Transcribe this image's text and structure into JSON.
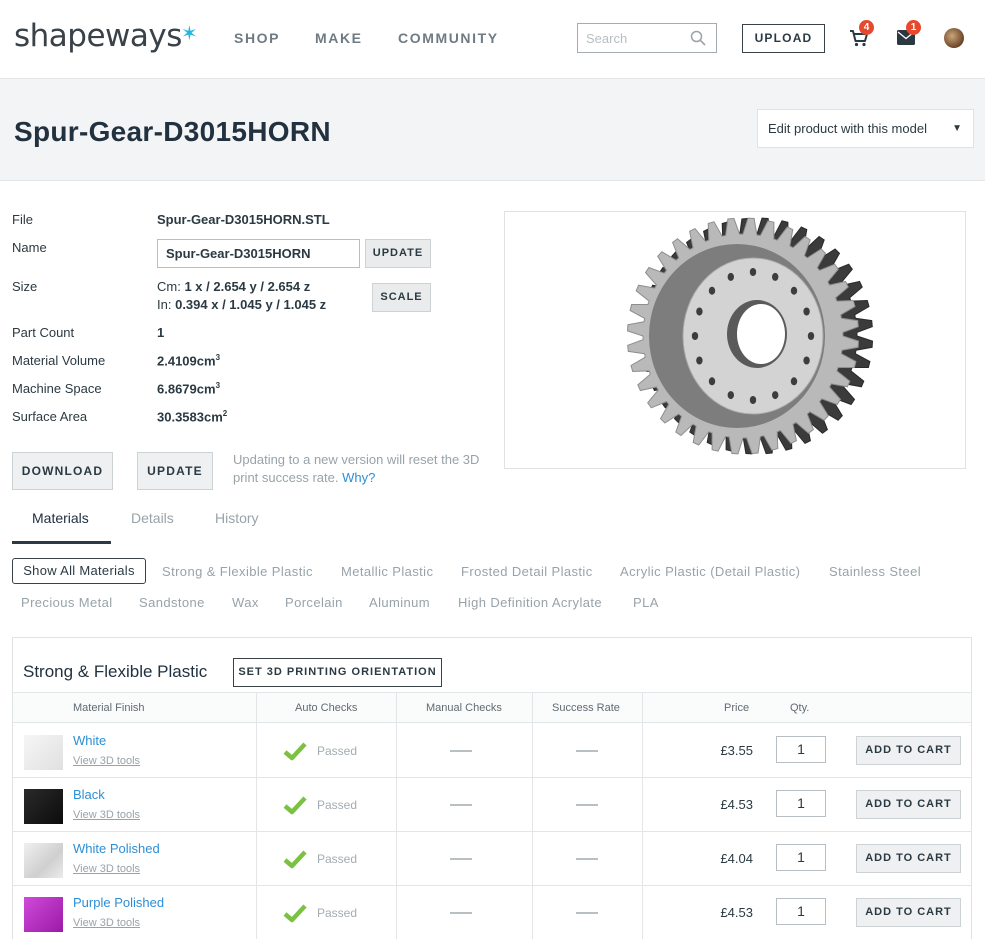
{
  "header": {
    "logo": "shapeways",
    "nav": [
      "SHOP",
      "MAKE",
      "COMMUNITY"
    ],
    "search_placeholder": "Search",
    "upload_label": "UPLOAD",
    "cart_count": "4",
    "mail_count": "1"
  },
  "page": {
    "title": "Spur-Gear-D3015HORN",
    "edit_select": "Edit product with this model"
  },
  "file_info": {
    "file_label": "File",
    "file_value": "Spur-Gear-D3015HORN.STL",
    "name_label": "Name",
    "name_value": "Spur-Gear-D3015HORN",
    "update_small": "UPDATE",
    "size_label": "Size",
    "size_cm_prefix": "Cm:",
    "size_cm": "1 x / 2.654 y / 2.654 z",
    "size_in_prefix": "In:",
    "size_in": "0.394 x / 1.045 y / 1.045 z",
    "scale_label": "SCALE",
    "part_count_label": "Part Count",
    "part_count": "1",
    "material_volume_label": "Material Volume",
    "material_volume": "2.4109cm",
    "machine_space_label": "Machine Space",
    "machine_space": "6.8679cm",
    "surface_area_label": "Surface Area",
    "surface_area": "30.3583cm",
    "unit_sup_3": "3",
    "unit_sup_2": "2",
    "download_label": "DOWNLOAD",
    "update_label": "UPDATE",
    "note": "Updating to a new version will reset the 3D print success rate.",
    "note_link": "Why?"
  },
  "tabs": [
    "Materials",
    "Details",
    "History"
  ],
  "material_filters": {
    "active": "Show All Materials",
    "row1": [
      "Strong & Flexible Plastic",
      "Metallic Plastic",
      "Frosted Detail Plastic",
      "Acrylic Plastic (Detail Plastic)",
      "Stainless Steel"
    ],
    "row2": [
      "Precious Metal",
      "Sandstone",
      "Wax",
      "Porcelain",
      "Aluminum",
      "High Definition Acrylate",
      "PLA"
    ]
  },
  "material_table": {
    "title": "Strong & Flexible Plastic",
    "orientation_button": "SET 3D PRINTING ORIENTATION",
    "headers": [
      "Material Finish",
      "Auto Checks",
      "Manual Checks",
      "Success Rate",
      "Price",
      "Qty."
    ],
    "tools_link": "View 3D tools",
    "passed_label": "Passed",
    "add_to_cart": "ADD TO CART",
    "rows": [
      {
        "name": "White",
        "price": "£3.55",
        "qty": "1",
        "swatch": "#eeeeee"
      },
      {
        "name": "Black",
        "price": "£4.53",
        "qty": "1",
        "swatch": "#161616"
      },
      {
        "name": "White Polished",
        "price": "£4.04",
        "qty": "1",
        "swatch": "#e2e2e2"
      },
      {
        "name": "Purple Polished",
        "price": "£4.53",
        "qty": "1",
        "swatch": "#b62bc0"
      }
    ]
  },
  "colors": {
    "accent_link": "#2d8fd5",
    "logo_star": "#20b7e5",
    "badge": "#e7492e",
    "check": "#7cc242"
  }
}
